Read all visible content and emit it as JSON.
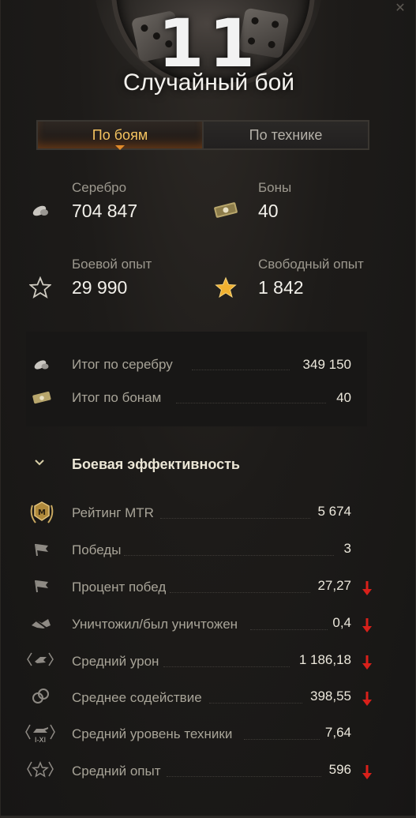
{
  "level": "11",
  "title": "Случайный бой",
  "tabs": [
    {
      "label": "По боям",
      "active": true
    },
    {
      "label": "По технике",
      "active": false
    }
  ],
  "stats": {
    "silver": {
      "label": "Серебро",
      "value": "704 847",
      "icon": "silver-icon"
    },
    "bonds": {
      "label": "Боны",
      "value": "40",
      "icon": "bonds-icon"
    },
    "combat_xp": {
      "label": "Боевой опыт",
      "value": "29 990",
      "icon": "star-outline-icon"
    },
    "free_xp": {
      "label": "Свободный опыт",
      "value": "1 842",
      "icon": "star-gold-icon"
    }
  },
  "totals": [
    {
      "label": "Итог по серебру",
      "value": "349 150",
      "icon": "silver-icon"
    },
    {
      "label": "Итог по бонам",
      "value": "40",
      "icon": "bonds-icon"
    }
  ],
  "efficiency": {
    "title": "Боевая эффективность",
    "rows": [
      {
        "label": "Рейтинг MTR",
        "value": "5 674",
        "icon": "mtr-rating-icon",
        "down": false
      },
      {
        "label": "Победы",
        "value": "3",
        "icon": "flag-icon",
        "down": false
      },
      {
        "label": "Процент побед",
        "value": "27,27",
        "icon": "flag-icon",
        "down": true
      },
      {
        "label": "Уничтожил/был уничтожен",
        "value": "0,4",
        "icon": "destroyed-icon",
        "down": true
      },
      {
        "label": "Средний урон",
        "value": "1 186,18",
        "icon": "damage-icon",
        "down": true
      },
      {
        "label": "Среднее содействие",
        "value": "398,55",
        "icon": "assist-icon",
        "down": true
      },
      {
        "label": "Средний уровень техники",
        "value": "7,64",
        "icon": "tank-tier-icon",
        "down": false
      },
      {
        "label": "Средний опыт",
        "value": "596",
        "icon": "avg-xp-icon",
        "down": true
      }
    ]
  },
  "colors": {
    "accent": "#f5c460",
    "down_arrow": "#d8201a",
    "gold_star": "#f0b030"
  }
}
